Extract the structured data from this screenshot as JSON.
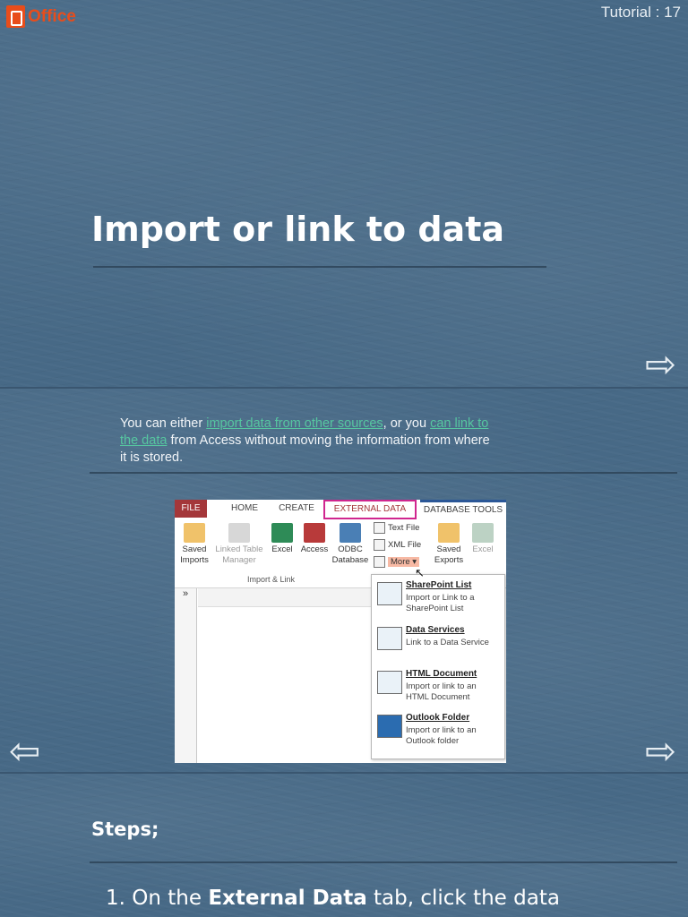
{
  "header": {
    "logo_text": "Office",
    "tutorial_label": "Tutorial : 17"
  },
  "slide1": {
    "title": "Import or link to data",
    "next_arrow": "⇨"
  },
  "slide2": {
    "para_part1": "You can either ",
    "link1": "import data from other sources",
    "para_part2": ", or you ",
    "link2": "can link to the data",
    "para_part3": " from Access without moving the information from where it is stored.",
    "prev_arrow": "⇦",
    "next_arrow": "⇨",
    "screenshot": {
      "tabs": [
        "FILE",
        "HOME",
        "CREATE",
        "EXTERNAL DATA",
        "DATABASE TOOLS"
      ],
      "ribbon_buttons": [
        {
          "label": "Saved Imports"
        },
        {
          "label": "Linked Table Manager"
        },
        {
          "label": "Excel"
        },
        {
          "label": "Access"
        },
        {
          "label": "ODBC Database"
        },
        {
          "label": "Saved Exports"
        },
        {
          "label": "Excel"
        }
      ],
      "mini_buttons": [
        "Text File",
        "XML File",
        "More ▾"
      ],
      "group_label": "Import & Link",
      "nav_glyph": "»",
      "menu": [
        {
          "title": "SharePoint List",
          "desc": "Import or Link to a SharePoint List"
        },
        {
          "title": "Data Services",
          "desc": "Link to a Data Service"
        },
        {
          "title": "HTML Document",
          "desc": "Import or link to an HTML Document"
        },
        {
          "title": "Outlook Folder",
          "desc": "Import or link to an Outlook folder"
        }
      ]
    }
  },
  "slide3": {
    "steps_heading": "Steps;",
    "step1_prefix": "1. On the ",
    "step1_bold": "External Data",
    "step1_suffix": " tab, click the data"
  },
  "colors": {
    "background": "#476986",
    "link": "#56c6a0",
    "office_orange": "#e84d1b",
    "file_tab": "#a4373a",
    "highlight": "#d0268f"
  }
}
